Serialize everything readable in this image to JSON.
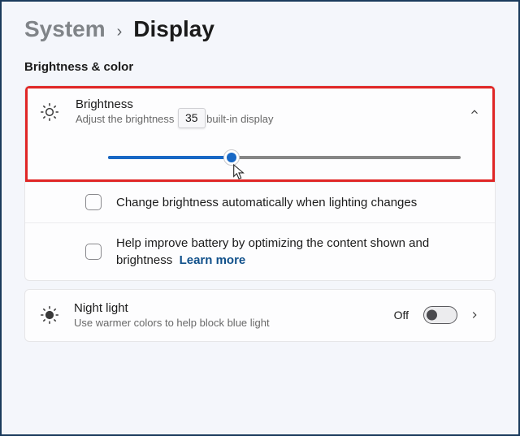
{
  "breadcrumb": {
    "parent": "System",
    "current": "Display"
  },
  "section": {
    "title": "Brightness & color"
  },
  "brightness": {
    "title": "Brightness",
    "subtitle_before": "Adjust the brightness",
    "subtitle_after": "built-in display",
    "value": "35",
    "slider_percent": 35
  },
  "auto_brightness": {
    "label": "Change brightness automatically when lighting changes"
  },
  "battery_optimize": {
    "label": "Help improve battery by optimizing the content shown and brightness",
    "learn_more": "Learn more"
  },
  "night_light": {
    "title": "Night light",
    "subtitle": "Use warmer colors to help block blue light",
    "state": "Off"
  }
}
